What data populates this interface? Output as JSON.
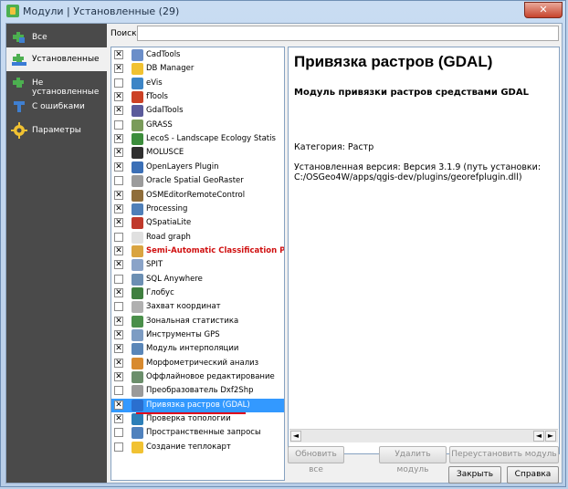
{
  "window": {
    "title": "Модули | Установленные (29)",
    "close_glyph": "✕"
  },
  "sidebar": {
    "items": [
      {
        "label": "Все",
        "icon": "puzzle-icon",
        "active": false
      },
      {
        "label": "Установленные",
        "icon": "installed-plugin-icon",
        "active": true
      },
      {
        "label": "Не установленные",
        "icon": "not-installed-plugin-icon",
        "active": false
      },
      {
        "label": "С ошибками",
        "icon": "broken-plugin-icon",
        "active": false
      },
      {
        "label": "Параметры",
        "icon": "gear-icon",
        "active": false
      }
    ]
  },
  "search": {
    "label": "Поиск",
    "value": ""
  },
  "plugins": [
    {
      "name": "CadTools",
      "checked": true,
      "icon_color": "#6b8ec9"
    },
    {
      "name": "DB Manager",
      "checked": true,
      "icon_color": "#f1c232"
    },
    {
      "name": "eVis",
      "checked": false,
      "icon_color": "#3d85c6"
    },
    {
      "name": "fTools",
      "checked": true,
      "icon_color": "#cc4125"
    },
    {
      "name": "GdalTools",
      "checked": true,
      "icon_color": "#5b5b9b"
    },
    {
      "name": "GRASS",
      "checked": false,
      "icon_color": "#7a9b5a"
    },
    {
      "name": "LecoS - Landscape Ecology Statis",
      "checked": true,
      "icon_color": "#3c8d3c"
    },
    {
      "name": "MOLUSCE",
      "checked": true,
      "icon_color": "#2f2f2f"
    },
    {
      "name": "OpenLayers Plugin",
      "checked": true,
      "icon_color": "#3b6fb6"
    },
    {
      "name": "Oracle Spatial GeoRaster",
      "checked": false,
      "icon_color": "#9b9b9b"
    },
    {
      "name": "OSMEditorRemoteControl",
      "checked": true,
      "icon_color": "#8f6d3a"
    },
    {
      "name": "Processing",
      "checked": true,
      "icon_color": "#4f7fb8"
    },
    {
      "name": "QSpatiaLite",
      "checked": true,
      "icon_color": "#c0392b"
    },
    {
      "name": "Road graph",
      "checked": false,
      "icon_color": "#e0e0e0"
    },
    {
      "name": "Semi-Automatic Classification Pl",
      "checked": true,
      "icon_color": "#d9a441",
      "red": true
    },
    {
      "name": "SPIT",
      "checked": true,
      "icon_color": "#8aa3c8"
    },
    {
      "name": "SQL Anywhere",
      "checked": false,
      "icon_color": "#6c8fb3"
    },
    {
      "name": "Глобус",
      "checked": true,
      "icon_color": "#3f7f3f"
    },
    {
      "name": "Захват координат",
      "checked": false,
      "icon_color": "#b0b0b0"
    },
    {
      "name": "Зональная статистика",
      "checked": true,
      "icon_color": "#4a8f4a"
    },
    {
      "name": "Инструменты GPS",
      "checked": true,
      "icon_color": "#7d9cc3"
    },
    {
      "name": "Модуль интерполяции",
      "checked": true,
      "icon_color": "#5a86b8"
    },
    {
      "name": "Морфометрический анализ",
      "checked": true,
      "icon_color": "#d88a2f"
    },
    {
      "name": "Оффлайновое редактирование",
      "checked": true,
      "icon_color": "#6b8e6b"
    },
    {
      "name": "Преобразователь Dxf2Shp",
      "checked": false,
      "icon_color": "#9a9a9a"
    },
    {
      "name": "Привязка растров (GDAL)",
      "checked": true,
      "icon_color": "#2a6fcf",
      "selected": true
    },
    {
      "name": "Проверка топологии",
      "checked": true,
      "icon_color": "#2c7fb8"
    },
    {
      "name": "Пространственные запросы",
      "checked": false,
      "icon_color": "#4f81bd"
    },
    {
      "name": "Создание теплокарт",
      "checked": false,
      "icon_color": "#f1c232"
    }
  ],
  "details": {
    "title": "Привязка растров (GDAL)",
    "subtitle": "Модуль привязки растров средствами GDAL",
    "category": "Категория: Растр",
    "installed_version": "Установленная версия: Версия 3.1.9 (путь установки: C:/OSGeo4W/apps/qgis-dev/plugins/georefplugin.dll)"
  },
  "buttons": {
    "update": "Обновить все",
    "uninstall": "Удалить модуль",
    "reinstall": "Переустановить модуль",
    "close": "Закрыть",
    "help": "Справка"
  },
  "scroll": {
    "left_arrow": "◄",
    "right_arrow": "►"
  },
  "colors": {
    "selection": "#3399ff",
    "highlight_underline": "#e0001a",
    "sidebar_bg": "#4a4a4a"
  }
}
